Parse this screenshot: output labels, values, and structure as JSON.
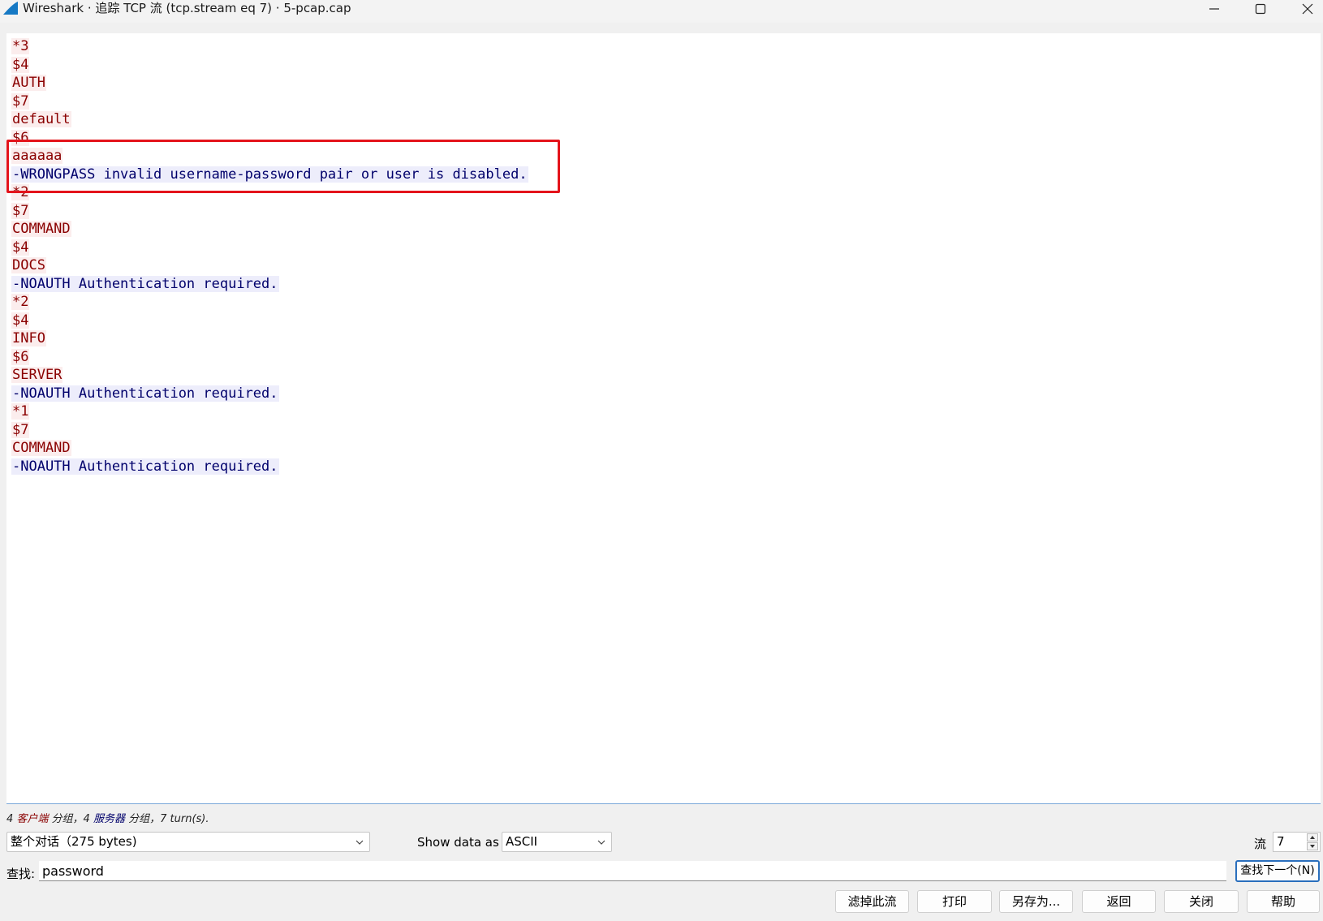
{
  "window": {
    "title": "Wireshark · 追踪 TCP 流 (tcp.stream eq 7) · 5-pcap.cap",
    "icons": {
      "app": "wireshark-fin-icon",
      "minimize": "minimize-icon",
      "maximize": "maximize-icon",
      "close": "close-icon"
    }
  },
  "stream": {
    "lines": [
      {
        "text": "*3",
        "dir": "client"
      },
      {
        "text": "$4",
        "dir": "client"
      },
      {
        "text": "AUTH",
        "dir": "client"
      },
      {
        "text": "$7",
        "dir": "client"
      },
      {
        "text": "default",
        "dir": "client"
      },
      {
        "text": "$6",
        "dir": "client"
      },
      {
        "text": "aaaaaa",
        "dir": "client"
      },
      {
        "text": "-WRONGPASS invalid username-password pair or user is disabled.",
        "dir": "server"
      },
      {
        "text": "*2",
        "dir": "client"
      },
      {
        "text": "$7",
        "dir": "client"
      },
      {
        "text": "COMMAND",
        "dir": "client"
      },
      {
        "text": "$4",
        "dir": "client"
      },
      {
        "text": "DOCS",
        "dir": "client"
      },
      {
        "text": "-NOAUTH Authentication required.",
        "dir": "server"
      },
      {
        "text": "*2",
        "dir": "client"
      },
      {
        "text": "$4",
        "dir": "client"
      },
      {
        "text": "INFO",
        "dir": "client"
      },
      {
        "text": "$6",
        "dir": "client"
      },
      {
        "text": "SERVER",
        "dir": "client"
      },
      {
        "text": "-NOAUTH Authentication required.",
        "dir": "server"
      },
      {
        "text": "*1",
        "dir": "client"
      },
      {
        "text": "$7",
        "dir": "client"
      },
      {
        "text": "COMMAND",
        "dir": "client"
      },
      {
        "text": "-NOAUTH Authentication required.",
        "dir": "server"
      }
    ],
    "colors": {
      "client_text": "#8a0000",
      "client_bg": "#fbeded",
      "server_text": "#00006b",
      "server_bg": "#ededfb",
      "highlight_box": "#e4141b"
    }
  },
  "summary": {
    "client_count": "4 ",
    "client_label": "客户端",
    "mid": " 分组，4 ",
    "server_label": "服务器",
    "tail": " 分组，7 turn(s)."
  },
  "controls": {
    "conversation_select": "整个对话（275 bytes)",
    "show_data_label": "Show data as",
    "show_data_value": "ASCII",
    "stream_label": "流",
    "stream_value": "7",
    "find_label": "查找:",
    "find_value": "password",
    "find_next_label": "查找下一个(N)"
  },
  "buttons": {
    "filter_out": "滤掉此流",
    "print": "打印",
    "save_as": "另存为...",
    "back": "返回",
    "close": "关闭",
    "help": "帮助"
  }
}
